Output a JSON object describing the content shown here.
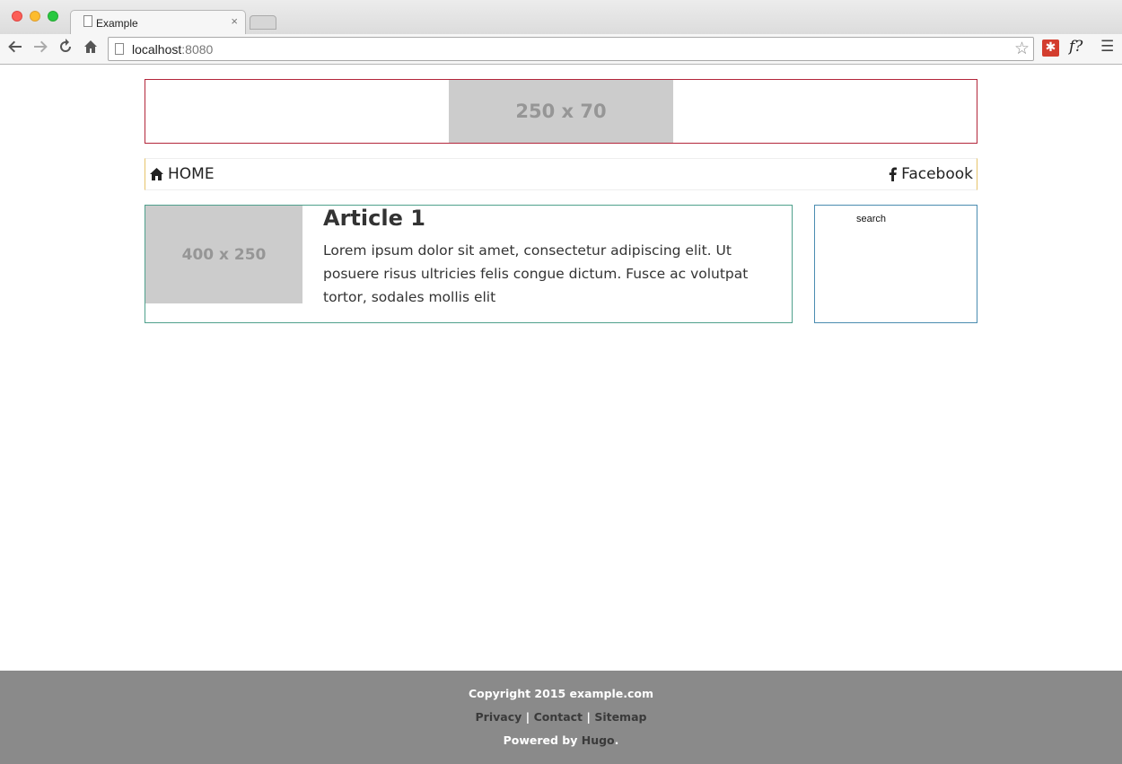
{
  "browser": {
    "tab_title": "Example",
    "tab_close": "×",
    "url_host": "localhost",
    "url_port": ":8080",
    "ext_f_label": "f?"
  },
  "header": {
    "banner_placeholder": "250 x 70"
  },
  "nav": {
    "home_label": "HOME",
    "facebook_label": "Facebook"
  },
  "article": {
    "thumb_placeholder": "400 x 250",
    "title": "Article 1",
    "body": "Lorem ipsum dolor sit amet, consectetur adipiscing elit. Ut posuere risus ultricies felis congue dictum. Fusce ac volutpat tortor, sodales mollis elit"
  },
  "sidebar": {
    "search_label": "search"
  },
  "footer": {
    "copyright": "Copyright 2015 example.com",
    "links": [
      "Privacy",
      "Contact",
      "Sitemap"
    ],
    "separator": "|",
    "powered_prefix": "Powered by",
    "powered_link": "Hugo",
    "powered_suffix": "."
  },
  "colors": {
    "banner_border": "#b3263b",
    "nav_border": "#e6c36a",
    "article_border": "#4fa08c",
    "sidebar_border": "#4a8cb0",
    "footer_bg": "#8a8a8a",
    "placeholder_bg": "#cccccc"
  }
}
